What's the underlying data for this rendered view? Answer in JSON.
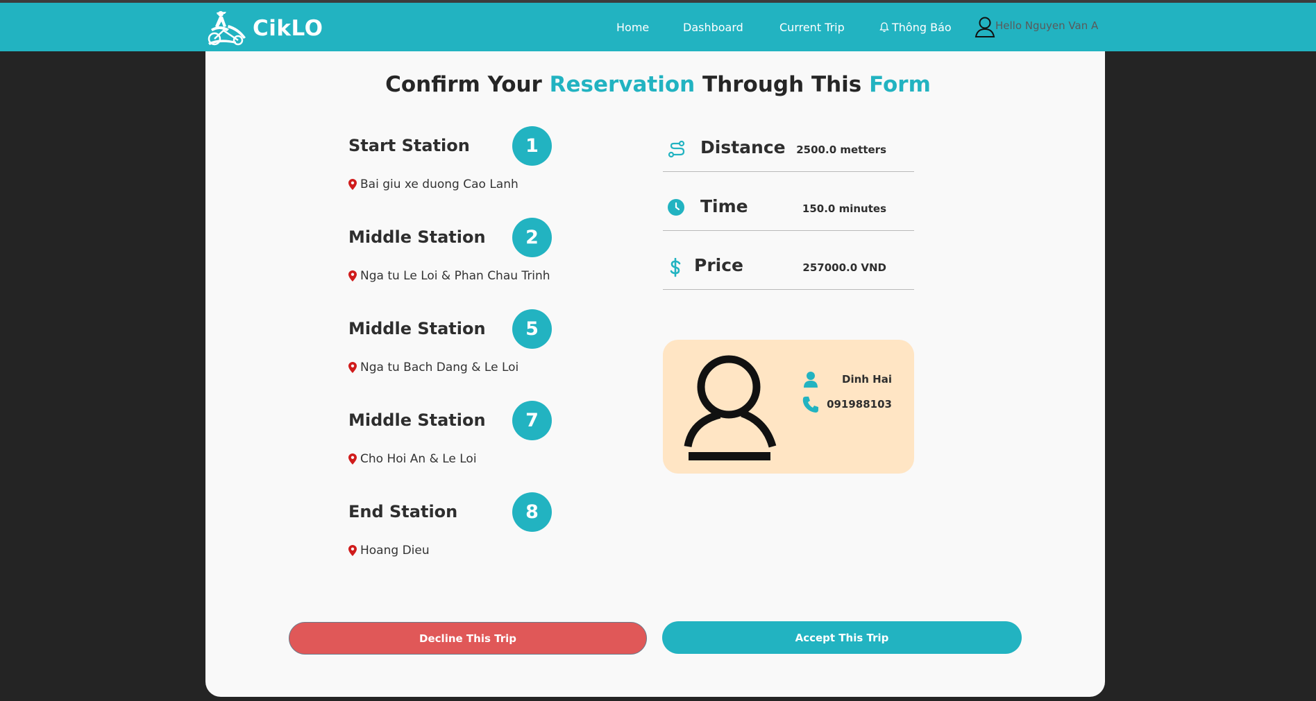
{
  "nav": {
    "brand": "CikLO",
    "links": [
      "Home",
      "Dashboard",
      "Current Trip",
      "Thông Báo"
    ],
    "greeting": "Hello Nguyen Van A"
  },
  "heading": {
    "part1": "Confirm Your ",
    "accent1": "Reservation",
    "part2": " Through This ",
    "accent2": "Form"
  },
  "stations": [
    {
      "title": "Start Station",
      "number": "1",
      "address": "Bai giu xe duong Cao Lanh"
    },
    {
      "title": "Middle Station",
      "number": "2",
      "address": "Nga tu Le Loi & Phan Chau Trinh"
    },
    {
      "title": "Middle Station",
      "number": "5",
      "address": "Nga tu Bach Dang & Le Loi"
    },
    {
      "title": "Middle Station",
      "number": "7",
      "address": "Cho Hoi An & Le Loi"
    },
    {
      "title": "End Station",
      "number": "8",
      "address": "Hoang Dieu"
    }
  ],
  "metrics": {
    "distance": {
      "label": "Distance",
      "value": "2500.0 metters",
      "icon": "route-icon"
    },
    "time": {
      "label": "Time",
      "value": "150.0 minutes",
      "icon": "clock-icon"
    },
    "price": {
      "label": "Price",
      "value": "257000.0 VND",
      "icon": "dollar-icon"
    }
  },
  "driver": {
    "name": "Dinh Hai",
    "phone": "091988103"
  },
  "buttons": {
    "decline": "Decline This Trip",
    "accept": "Accept This Trip"
  },
  "colors": {
    "accent": "#22b3c1",
    "decline": "#e05858",
    "driver_card": "#ffe5c4",
    "pin": "#d01c1c"
  }
}
